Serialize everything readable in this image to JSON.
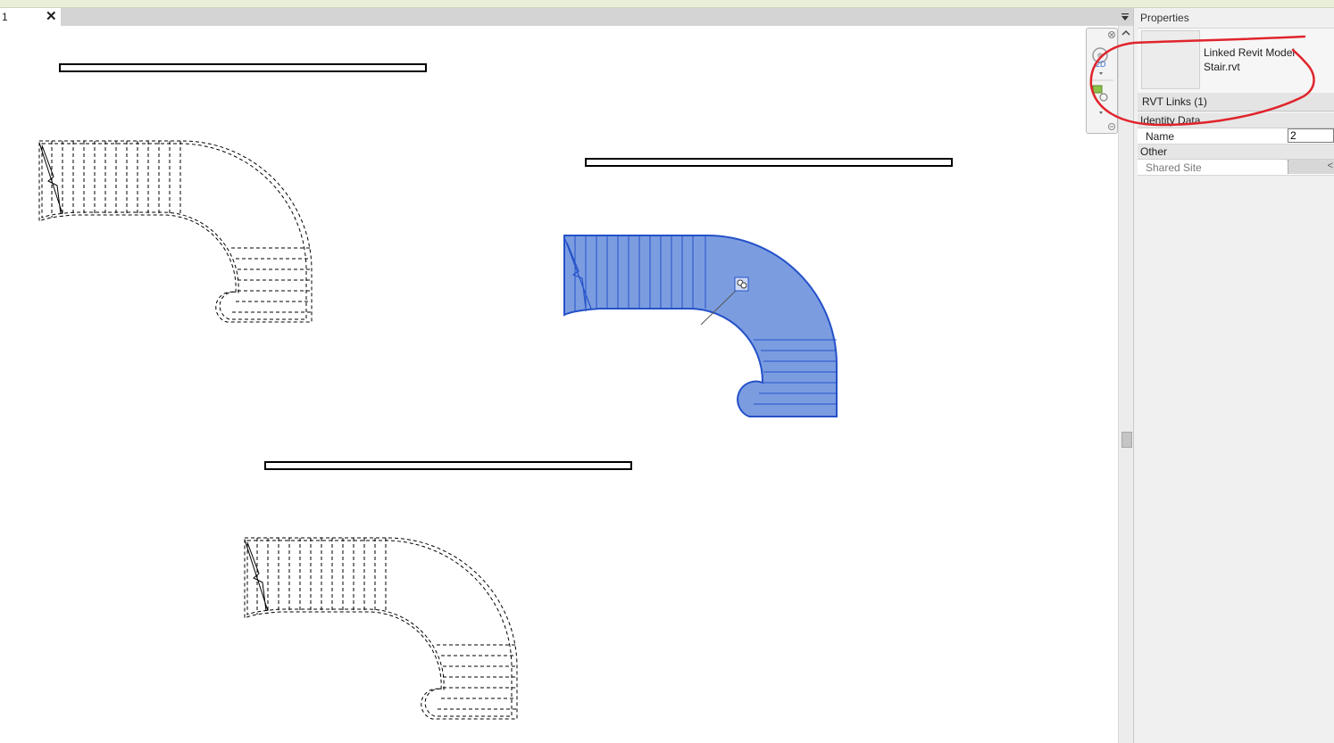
{
  "view_tab": {
    "label": "1",
    "close_glyph": "✕"
  },
  "properties": {
    "title": "Properties",
    "type_family": "Linked Revit Model",
    "type_name": "Stair.rvt",
    "instance_selector": "RVT Links (1)",
    "groups": [
      {
        "name": "Identity Data",
        "params": [
          {
            "label": "Name",
            "value": "2"
          }
        ]
      },
      {
        "name": "Other",
        "params": [
          {
            "label": "Shared Site",
            "button_glyph": "<"
          }
        ]
      }
    ]
  },
  "icons": {
    "tab_menu": "dropdown-triangle-icon",
    "nav": [
      "close-icon",
      "steering-wheel-icon",
      "2d-wheel-icon",
      "zoom-region-icon",
      "customize-icon"
    ],
    "scroll_up": "chevron-up-icon"
  },
  "colors": {
    "selection_fill": "#7b9de0",
    "selection_stroke": "#2451c9",
    "markup_red": "#e0242c"
  }
}
